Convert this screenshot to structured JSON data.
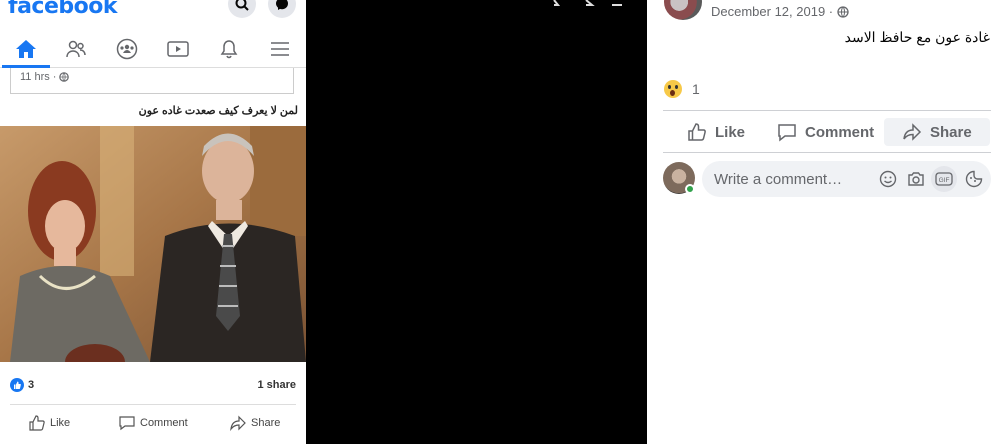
{
  "left_mobile": {
    "logo": "facebook",
    "post": {
      "time": "11 hrs ·",
      "text": "لمن لا يعرف كيف صعدت غاده عون",
      "reaction_count": "3",
      "share_count": "1 share"
    },
    "actions": {
      "like": "Like",
      "comment": "Comment",
      "share": "Share"
    },
    "tabs": [
      "home-tab",
      "friends-tab",
      "groups-tab",
      "watch-tab",
      "notifications-tab",
      "menu-tab"
    ]
  },
  "right_panel": {
    "date": "December 12, 2019 ·",
    "caption": "غادة عون مع حافظ الاسد",
    "reaction_count": "1",
    "actions": {
      "like": "Like",
      "comment": "Comment",
      "share": "Share"
    },
    "comment_placeholder": "Write a comment…"
  },
  "colors": {
    "brand": "#1877f2",
    "secondary_text": "#65676b",
    "online": "#31a24c"
  }
}
